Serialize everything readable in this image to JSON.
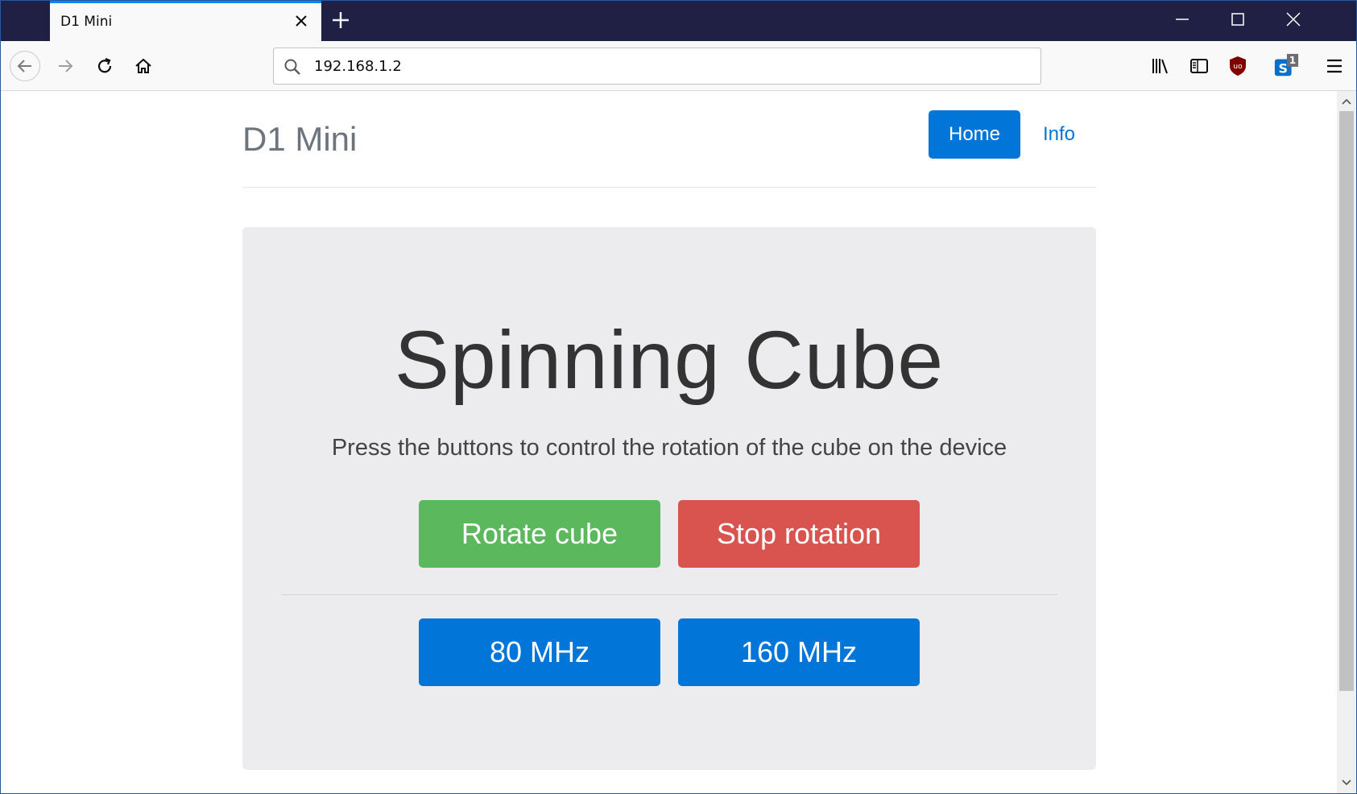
{
  "browser": {
    "tab_title": "D1 Mini",
    "url": "192.168.1.2",
    "extension_badge": "1",
    "ublock_label": "uo"
  },
  "page": {
    "brand": "D1 Mini",
    "nav": {
      "home": "Home",
      "info": "Info"
    },
    "jumbotron": {
      "title": "Spinning Cube",
      "lead": "Press the buttons to control the rotation of the cube on the device",
      "rotate_button": "Rotate cube",
      "stop_button": "Stop rotation",
      "freq_80_button": "80 MHz",
      "freq_160_button": "160 MHz"
    }
  },
  "colors": {
    "primary": "#0275d8",
    "success": "#5cb85c",
    "danger": "#d9534f",
    "tabbar": "#1f2044"
  }
}
